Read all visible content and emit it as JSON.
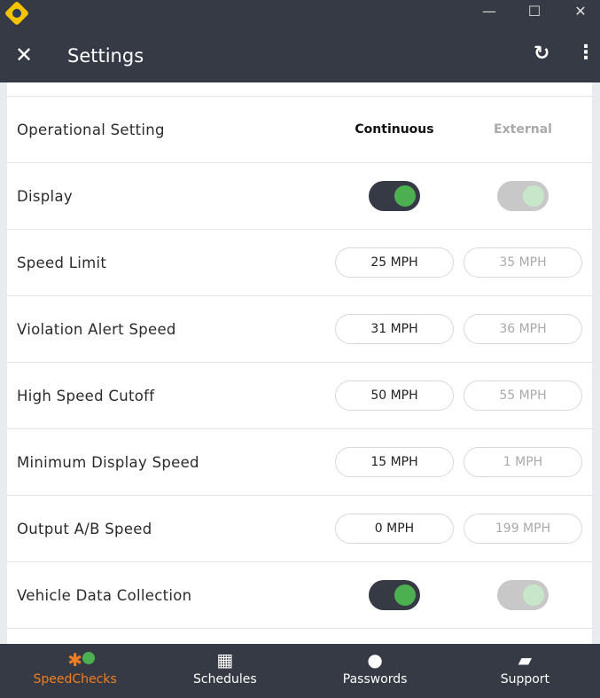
{
  "header": {
    "title": "Settings"
  },
  "columns": {
    "a": "Continuous",
    "b": "External"
  },
  "rows": [
    {
      "label": "Operational Setting",
      "type": "header"
    },
    {
      "label": "Display",
      "type": "toggle"
    },
    {
      "label": "Speed Limit",
      "a": "25 MPH",
      "b": "35 MPH"
    },
    {
      "label": "Violation Alert Speed",
      "a": "31 MPH",
      "b": "36 MPH"
    },
    {
      "label": "High Speed Cutoff",
      "a": "50 MPH",
      "b": "55 MPH"
    },
    {
      "label": "Minimum Display Speed",
      "a": "15 MPH",
      "b": "1 MPH"
    },
    {
      "label": "Output A/B Speed",
      "a": "0 MPH",
      "b": "199 MPH"
    },
    {
      "label": "Vehicle Data Collection",
      "type": "toggle"
    }
  ],
  "nav": [
    {
      "label": "SpeedChecks",
      "icon": "bluetooth-icon"
    },
    {
      "label": "Schedules",
      "icon": "calendar-icon"
    },
    {
      "label": "Passwords",
      "icon": "person-icon"
    },
    {
      "label": "Support",
      "icon": "chat-icon"
    }
  ],
  "colors": {
    "accent": "#f07f23",
    "header": "#363a44",
    "toggle_on": "#4caf50"
  }
}
